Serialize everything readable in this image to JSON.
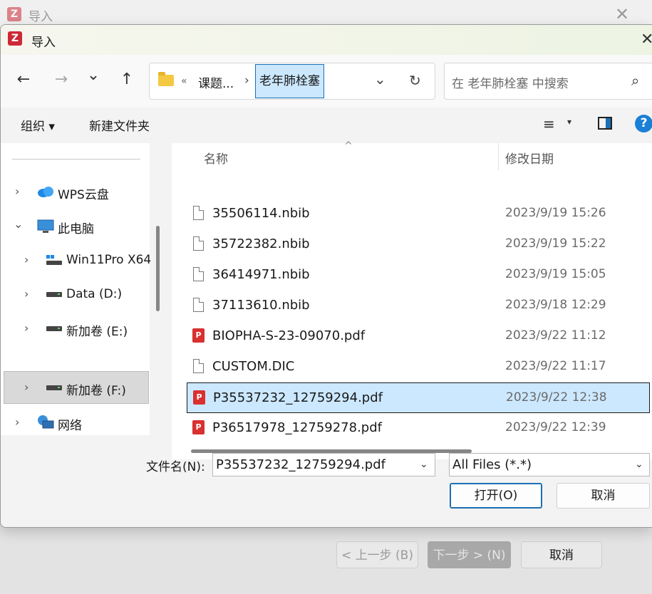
{
  "background_window": {
    "title": "导入",
    "back_button": "< 上一步 (B)",
    "next_button": "下一步 > (N)",
    "cancel_button": "取消"
  },
  "dialog": {
    "title": "导入",
    "logo_letter": "Z",
    "close_glyph": "✕"
  },
  "navigation": {
    "back_glyph": "←",
    "forward_glyph": "→",
    "recent_glyph": "⌄",
    "up_glyph": "↑"
  },
  "address_bar": {
    "overflow": "«",
    "parent": "课题...",
    "separator": "›",
    "current": "老年肺栓塞",
    "dropdown_glyph": "⌄",
    "refresh_glyph": "↻"
  },
  "search": {
    "placeholder": "在 老年肺栓塞 中搜索",
    "icon_glyph": "⌕"
  },
  "command_bar": {
    "organize": "组织 ▾",
    "new_folder": "新建文件夹",
    "view_glyph": "≡",
    "view_dropdown": "▾",
    "help_glyph": "?"
  },
  "sidebar": {
    "items": [
      {
        "label": "WPS云盘",
        "chevron": "›"
      },
      {
        "label": "此电脑",
        "chevron": "⌄"
      },
      {
        "label": "Win11Pro X64",
        "chevron": "›"
      },
      {
        "label": "Data (D:)",
        "chevron": "›"
      },
      {
        "label": "新加卷 (E:)",
        "chevron": "›"
      },
      {
        "label": "新加卷 (F:)",
        "chevron": "›"
      },
      {
        "label": "网络",
        "chevron": "›"
      }
    ]
  },
  "file_list": {
    "col_name": "名称",
    "col_date": "修改日期",
    "sort_glyph": "^",
    "files": [
      {
        "name": "35506114.nbib",
        "date": "2023/9/19 15:26",
        "type": "doc"
      },
      {
        "name": "35722382.nbib",
        "date": "2023/9/19 15:22",
        "type": "doc"
      },
      {
        "name": "36414971.nbib",
        "date": "2023/9/19 15:05",
        "type": "doc"
      },
      {
        "name": "37113610.nbib",
        "date": "2023/9/18 12:29",
        "type": "doc"
      },
      {
        "name": "BIOPHA-S-23-09070.pdf",
        "date": "2023/9/22 11:12",
        "type": "pdf"
      },
      {
        "name": "CUSTOM.DIC",
        "date": "2023/9/22 11:17",
        "type": "doc"
      },
      {
        "name": "P35537232_12759294.pdf",
        "date": "2023/9/22 12:38",
        "type": "pdf",
        "selected": true
      },
      {
        "name": "P36517978_12759278.pdf",
        "date": "2023/9/22 12:39",
        "type": "pdf"
      }
    ],
    "pdf_icon_glyph": "P"
  },
  "footer": {
    "filename_label": "文件名(N):",
    "filename_value": "P35537232_12759294.pdf",
    "filetype_value": "All Files (*.*)",
    "dropdown_glyph": "⌄",
    "open_button": "打开(O)",
    "cancel_button": "取消"
  }
}
